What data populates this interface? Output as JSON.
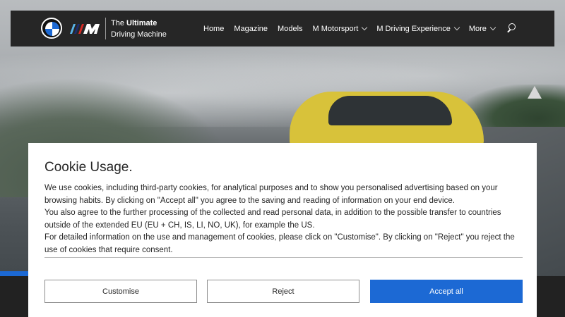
{
  "header": {
    "tagline_prefix": "The ",
    "tagline_strong": "Ultimate",
    "tagline_line2": "Driving Machine",
    "nav": [
      {
        "label": "Home",
        "has_dropdown": false
      },
      {
        "label": "Magazine",
        "has_dropdown": false
      },
      {
        "label": "Models",
        "has_dropdown": false
      },
      {
        "label": "M Motorsport",
        "has_dropdown": true
      },
      {
        "label": "M Driving Experience",
        "has_dropdown": true
      },
      {
        "label": "More",
        "has_dropdown": true
      }
    ],
    "search_icon": "search-icon"
  },
  "cookie": {
    "title": "Cookie Usage.",
    "paragraphs": [
      "We use cookies, including third-party cookies, for analytical purposes and to show you personalised advertising based on your browsing habits. By clicking on \"Accept all\" you agree to the saving and reading of information on your end device.",
      "You also agree to the further processing of the collected and read personal data, in addition to the possible transfer to countries outside of the extended EU (EU + CH, IS, LI, NO, UK), for example the US.",
      "For detailed information on the use and management of cookies, please click on \"Customise\". By clicking on \"Reject\" you reject the use of cookies that require consent."
    ],
    "buttons": {
      "customise": "Customise",
      "reject": "Reject",
      "accept": "Accept all"
    }
  },
  "colors": {
    "accent": "#1c69d4",
    "navbar": "#262626"
  }
}
